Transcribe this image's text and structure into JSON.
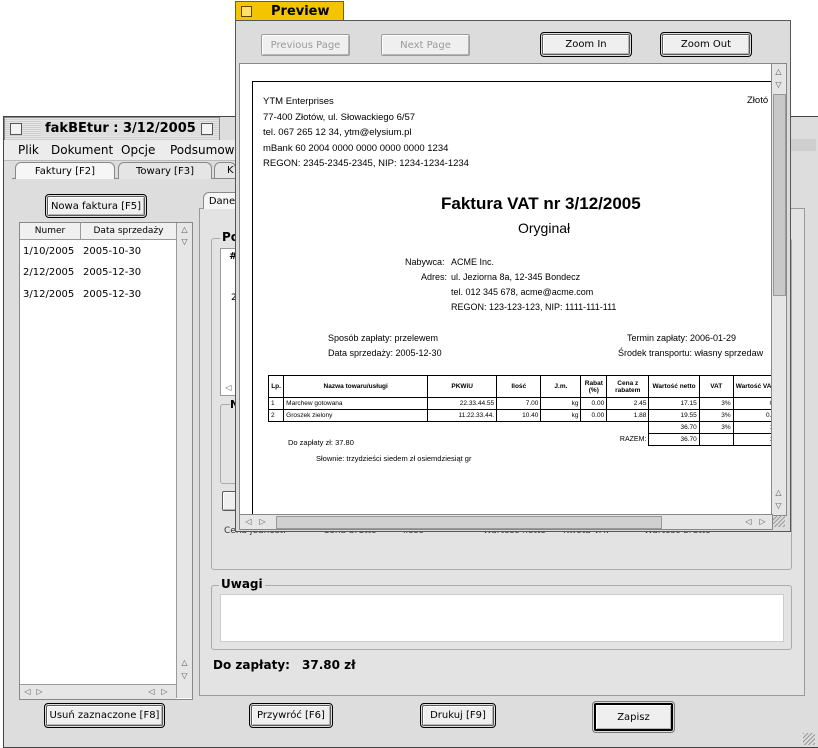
{
  "main_window": {
    "title": "fakBEtur : 3/12/2005",
    "menu": [
      "Plik",
      "Dokument",
      "Opcje",
      "Podsumowan"
    ],
    "tabs": [
      "Faktury [F2]",
      "Towary [F3]",
      "K"
    ],
    "new_invoice_button": "Nowa faktura [F5]",
    "list_headers": [
      "Numer",
      "Data sprzedaży"
    ],
    "invoices": [
      {
        "numer": "1/10/2005",
        "data": "2005-10-30"
      },
      {
        "numer": "2/12/2005",
        "data": "2005-12-30"
      },
      {
        "numer": "3/12/2005",
        "data": "2005-12-30"
      }
    ],
    "subtab": "Dane",
    "group_labels": {
      "position_group": "Po",
      "n_group": "N"
    },
    "hidden_grid_headers": [
      "#"
    ],
    "hidden_row_cell": "2",
    "bottom_row_headers": [
      "Cena jednost.",
      "Cena brutto",
      "Ilość",
      "Wartość netto",
      "Kwota VAT",
      "Wartość brutto"
    ],
    "notes_label": "Uwagi",
    "notes_value": "",
    "total_label": "Do zapłaty:",
    "total_value": "37.80 zł",
    "buttons": {
      "delete": "Usuń zaznaczone [F8]",
      "restore": "Przywróć [F6]",
      "print": "Drukuj [F9]",
      "save": "Zapisz"
    }
  },
  "preview_window": {
    "title": "Preview",
    "buttons": {
      "previous": "Previous Page",
      "next": "Next Page",
      "zoom_in": "Zoom In",
      "zoom_out": "Zoom Out"
    }
  },
  "invoice": {
    "seller_lines": [
      "YTM Enterprises",
      "77-400 Złotów, ul. Słowackiego 6/57",
      "tel. 067 265 12 34, ytm@elysium.pl",
      "mBank 60 2004 0000 0000 0000 0000 1234",
      "REGON: 2345-2345-2345, NIP: 1234-1234-1234"
    ],
    "place": "Złotó",
    "title": "Faktura VAT nr 3/12/2005",
    "subtitle": "Oryginał",
    "buyer_label": "Nabywca:",
    "buyer_name": "ACME Inc.",
    "address_label": "Adres:",
    "address": "ul. Jeziorna 8a, 12-345 Bondecz",
    "phone": "tel. 012 345 678, acme@acme.com",
    "ids": "REGON: 123-123-123, NIP: 1111-111-111",
    "payment_method": "Sposób zapłaty: przelewem",
    "payment_term": "Termin zapłaty: 2006-01-29",
    "sale_date": "Data sprzedaży: 2005-12-30",
    "transport": "Środek transportu: własny sprzedaw",
    "table_headers": [
      "Lp.",
      "Nazwa towaru/usługi",
      "PKWiU",
      "Ilość",
      "J.m.",
      "Rabat (%)",
      "Cena z rabatem",
      "Wartość netto",
      "VAT",
      "Wartość VAT"
    ],
    "rows": [
      {
        "lp": "1",
        "name": "Marchew gotowana",
        "pkwiu": "22.33.44.55",
        "qty": "7.00",
        "unit": "kg",
        "rabat": "0.00",
        "price": "2.45",
        "net": "17.15",
        "vat": "3%",
        "vat_val": "0."
      },
      {
        "lp": "2",
        "name": "Groszek zielony",
        "pkwiu": "11.22.33.44.",
        "qty": "10.40",
        "unit": "kg",
        "rabat": "0.00",
        "price": "1.88",
        "net": "19.55",
        "vat": "3%",
        "vat_val": "0.5"
      }
    ],
    "subtotal": {
      "net": "36.70",
      "vat": "3%",
      "vat_val": "1."
    },
    "razem_label": "RAZEM:",
    "razem": {
      "net": "36.70",
      "vat_val": "1."
    },
    "to_pay": "Do zapłaty zł: 37.80",
    "in_words": "Słownie: trzydzieści siedem zł osiemdziesiąt gr"
  }
}
